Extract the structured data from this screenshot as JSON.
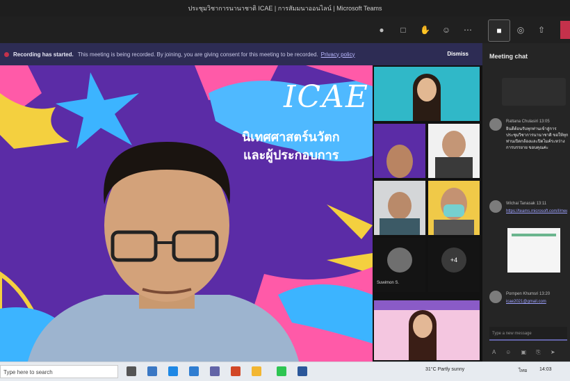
{
  "window": {
    "title": "ประชุมวิชาการนานาชาติ ICAE | การสัมมนาออนไลน์ | Microsoft Teams"
  },
  "toolbar": {
    "icons": [
      "people-icon",
      "chat-icon",
      "hand-icon",
      "more-icon",
      "camera-icon",
      "mic-icon",
      "share-icon"
    ]
  },
  "recording_banner": {
    "title": "Recording has started.",
    "message": "This meeting is being recorded. By joining, you are giving consent for this meeting to be recorded.",
    "link": "Privacy policy",
    "dismiss": "Dismiss"
  },
  "main_video": {
    "background_text": "ICAE",
    "thai_line1": "นิเทศศาสตร์นวัตก",
    "thai_line2": "และผู้ประกอบการ"
  },
  "gallery": {
    "tiles": [
      {
        "label": ""
      },
      {
        "label": ""
      },
      {
        "label": ""
      },
      {
        "label": ""
      },
      {
        "label": ""
      },
      {
        "name": "Suwimon S."
      },
      {
        "label": "+4"
      },
      {
        "label": ""
      }
    ]
  },
  "chat": {
    "header": "Meeting chat",
    "messages": [
      {
        "name": "Rattana Chulasiri  13:05",
        "text": "ยินดีต้อนรับทุกท่านเข้าสู่การประชุมวิชาการนานาชาติ ขอให้ทุกท่านเปิดกล้องและปิดไมค์ระหว่างการบรรยาย ขอบคุณค่ะ"
      },
      {
        "name": "Wichai Tanasak  13:11",
        "text": "https://teams.microsoft.com/l/meetup",
        "link": true
      },
      {
        "name": "Pornpen Khumsri  13:20",
        "text": "icae2021@gmail.com",
        "link": true
      }
    ],
    "input_placeholder": "Type a new message"
  },
  "taskbar": {
    "search_placeholder": "Type here to search",
    "weather": "31°C Partly sunny",
    "time": "14:03",
    "lang": "ไทย"
  },
  "colors": {
    "teams_purple": "#6264a7",
    "banner": "#2d2c54",
    "leave_red": "#c4314b",
    "slide_bg": "#5b2ca6"
  }
}
